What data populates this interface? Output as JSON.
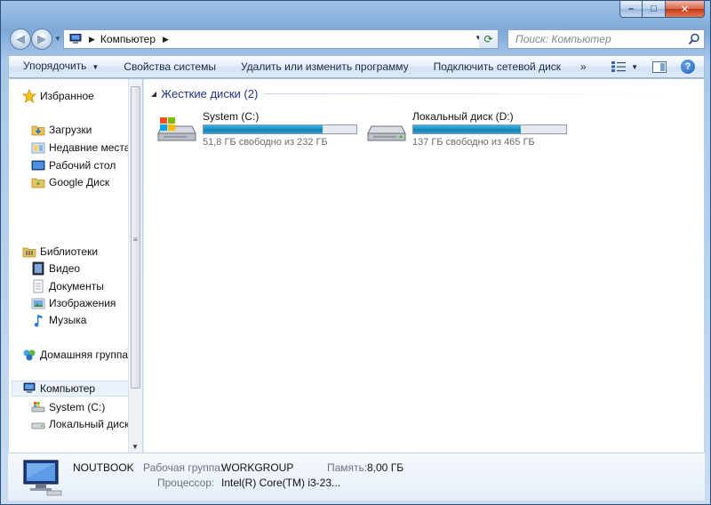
{
  "window": {
    "caption": {
      "minimize": "–",
      "maximize": "□",
      "close": "✕"
    }
  },
  "address": {
    "path_segment": "Компьютер",
    "search_placeholder": "Поиск: Компьютер"
  },
  "toolbar": {
    "organize": "Упорядочить",
    "system_properties": "Свойства системы",
    "uninstall": "Удалить или изменить программу",
    "map_drive": "Подключить сетевой диск",
    "more": "»"
  },
  "sidebar": {
    "favorites": "Избранное",
    "favorites_items": [
      "Загрузки",
      "Недавние места",
      "Рабочий стол",
      "Google Диск"
    ],
    "libraries": "Библиотеки",
    "libraries_items": [
      "Видео",
      "Документы",
      "Изображения",
      "Музыка"
    ],
    "homegroup": "Домашняя группа",
    "computer": "Компьютер",
    "computer_items": [
      "System (C:)",
      "Локальный диск"
    ]
  },
  "content": {
    "group_title": "Жесткие диски (2)",
    "drives": [
      {
        "name": "System (C:)",
        "free_text": "51,8 ГБ свободно из 232 ГБ",
        "used_fraction": 0.777
      },
      {
        "name": "Локальный диск (D:)",
        "free_text": "137 ГБ свободно из 465 ГБ",
        "used_fraction": 0.705
      }
    ]
  },
  "details": {
    "computer_name": "NOUTBOOK",
    "workgroup_label": "Рабочая группа:",
    "workgroup_value": "WORKGROUP",
    "memory_label": "Память:",
    "memory_value": "8,00 ГБ",
    "cpu_label": "Процессор:",
    "cpu_value": "Intel(R) Core(TM) i3-23..."
  },
  "colors": {
    "accent": "#1e3287",
    "drive_bar": "#1d8fc2"
  }
}
